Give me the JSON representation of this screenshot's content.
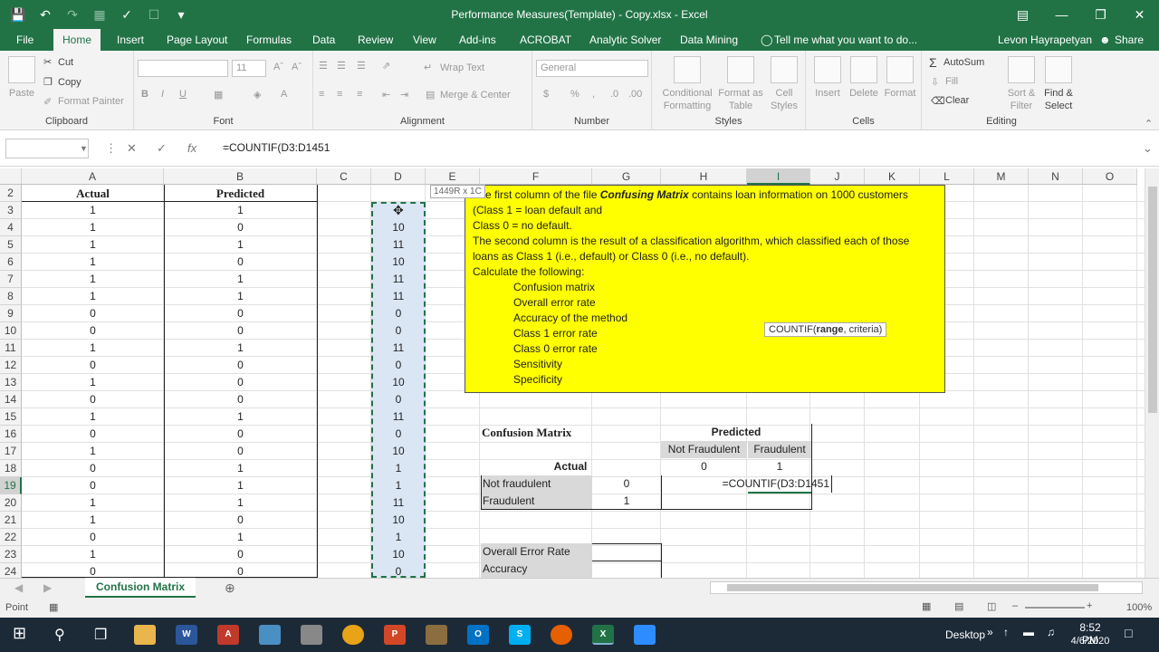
{
  "window": {
    "title": "Performance Measures(Template) - Copy.xlsx  -  Excel"
  },
  "tabs": {
    "items": [
      "File",
      "Home",
      "Insert",
      "Page Layout",
      "Formulas",
      "Data",
      "Review",
      "View",
      "Add-ins",
      "ACROBAT",
      "Analytic Solver",
      "Data Mining"
    ],
    "tell_me": "Tell me what you want to do...",
    "user": "Levon Hayrapetyan",
    "share": "Share"
  },
  "ribbon": {
    "clipboard": {
      "paste": "Paste",
      "cut": "Cut",
      "copy": "Copy",
      "format_painter": "Format Painter",
      "name": "Clipboard"
    },
    "font": {
      "size": "11",
      "name": "Font"
    },
    "alignment": {
      "wrap": "Wrap Text",
      "merge": "Merge & Center",
      "name": "Alignment"
    },
    "number": {
      "format": "General",
      "name": "Number"
    },
    "styles": {
      "cond_1": "Conditional",
      "cond_2": "Formatting",
      "table_1": "Format as",
      "table_2": "Table",
      "cell_1": "Cell",
      "cell_2": "Styles",
      "name": "Styles"
    },
    "cells": {
      "insert": "Insert",
      "delete": "Delete",
      "format": "Format",
      "name": "Cells"
    },
    "editing": {
      "autosum": "AutoSum",
      "fill": "Fill",
      "clear": "Clear",
      "sort_1": "Sort &",
      "sort_2": "Filter",
      "find_1": "Find &",
      "find_2": "Select",
      "name": "Editing"
    }
  },
  "formula_bar": {
    "name_box": "",
    "formula": "=COUNTIF(D3:D1451"
  },
  "columns": [
    "A",
    "B",
    "C",
    "D",
    "E",
    "F",
    "G",
    "H",
    "I",
    "J",
    "K",
    "L",
    "M",
    "N",
    "O"
  ],
  "selected_column": "I",
  "rows": [
    2,
    3,
    4,
    5,
    6,
    7,
    8,
    9,
    10,
    11,
    12,
    13,
    14,
    15,
    16,
    17,
    18,
    19,
    20,
    21,
    22,
    23,
    24
  ],
  "selected_row": 19,
  "headers": {
    "actual": "Actual",
    "predicted": "Predicted"
  },
  "table_rows": [
    {
      "a": "1",
      "b": "1",
      "d": ""
    },
    {
      "a": "1",
      "b": "0",
      "d": "10"
    },
    {
      "a": "1",
      "b": "1",
      "d": "11"
    },
    {
      "a": "1",
      "b": "0",
      "d": "10"
    },
    {
      "a": "1",
      "b": "1",
      "d": "11"
    },
    {
      "a": "1",
      "b": "1",
      "d": "11"
    },
    {
      "a": "0",
      "b": "0",
      "d": "0"
    },
    {
      "a": "0",
      "b": "0",
      "d": "0"
    },
    {
      "a": "1",
      "b": "1",
      "d": "11"
    },
    {
      "a": "0",
      "b": "0",
      "d": "0"
    },
    {
      "a": "1",
      "b": "0",
      "d": "10"
    },
    {
      "a": "0",
      "b": "0",
      "d": "0"
    },
    {
      "a": "1",
      "b": "1",
      "d": "11"
    },
    {
      "a": "0",
      "b": "0",
      "d": "0"
    },
    {
      "a": "1",
      "b": "0",
      "d": "10"
    },
    {
      "a": "0",
      "b": "1",
      "d": "1"
    },
    {
      "a": "0",
      "b": "1",
      "d": "1"
    },
    {
      "a": "1",
      "b": "1",
      "d": "11"
    },
    {
      "a": "1",
      "b": "0",
      "d": "10"
    },
    {
      "a": "0",
      "b": "1",
      "d": "1"
    },
    {
      "a": "1",
      "b": "0",
      "d": "10"
    },
    {
      "a": "0",
      "b": "0",
      "d": "0"
    }
  ],
  "selection_tip": "1449R x 1C",
  "instructions": {
    "line1_a": "The first column of the file ",
    "line1_b": "Confusing Matrix",
    "line1_c": " contains loan information on 1000 customers",
    "line2": "(Class 1 = loan default and",
    "line3": "Class 0 = no default.",
    "line4": "The second column is the result of a classification algorithm, which classified each of those",
    "line5": "loans as Class 1  (i.e., default) or Class 0 (i.e., no default).",
    "line6": "Calculate the following:",
    "items": [
      "Confusion matrix",
      "Overall error rate",
      "Accuracy of the method",
      "Class 1 error rate",
      "Class 0 error rate",
      "Sensitivity",
      "Specificity"
    ]
  },
  "function_tip": {
    "fn": "COUNTIF(",
    "arg1": "range",
    "rest": ", criteria)"
  },
  "confusion": {
    "title": "Confusion Matrix",
    "predicted": "Predicted",
    "not_fraudulent_col": "Not Fraudulent",
    "fraudulent_col": "Fraudulent",
    "actual": "Actual",
    "col_val_0": "0",
    "col_val_1": "1",
    "not_fraudulent_row": "Not fraudulent",
    "row_val_0": "0",
    "fraudulent_row": "Fraudulent",
    "row_val_1": "1",
    "editing": "=COUNTIF(D3:D1451",
    "overall_error": "Overall Error Rate",
    "accuracy": "Accuracy"
  },
  "sheet_tab": "Confusion Matrix",
  "status": {
    "mode": "Point",
    "zoom": "100%"
  },
  "taskbar": {
    "desktop": "Desktop",
    "time": "8:52 PM",
    "date": "4/6/2020"
  },
  "colors": {
    "excel_green": "#217346",
    "yellow": "#ffff00",
    "selection": "#dbe6f4"
  }
}
